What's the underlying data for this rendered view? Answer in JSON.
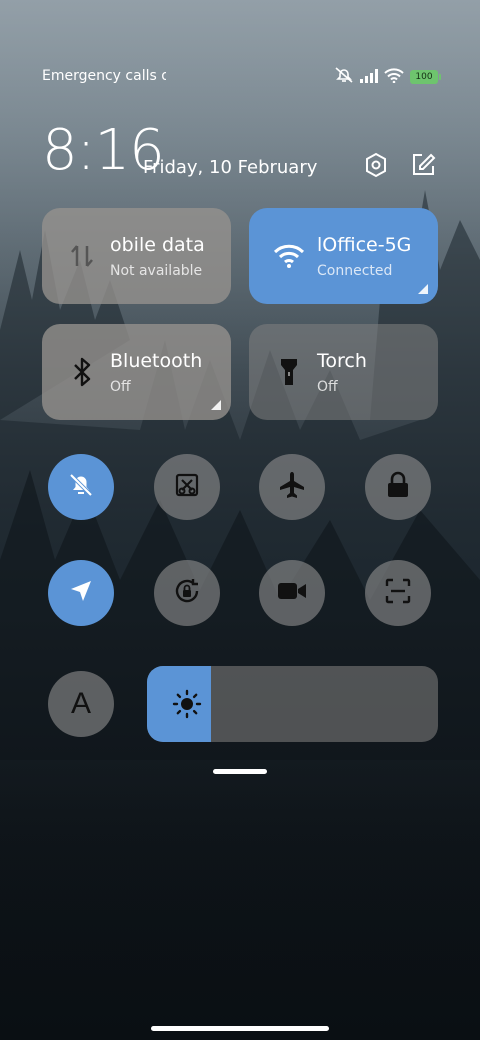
{
  "status_bar": {
    "carrier_text": "Emergency calls o",
    "battery_level": "100",
    "icons": [
      "mute-icon",
      "signal-icon",
      "wifi-icon",
      "battery-icon"
    ]
  },
  "header": {
    "time": "8:16",
    "date": "Friday, 10 February",
    "icons": [
      "settings-icon",
      "edit-icon"
    ]
  },
  "tiles": {
    "mobile_data": {
      "title": "obile data",
      "subtitle": "Not available",
      "icon": "data-arrows-icon",
      "active": false
    },
    "wifi": {
      "title": "lOffice-5G",
      "subtitle": "Connected",
      "icon": "wifi-icon",
      "active": true
    },
    "bluetooth": {
      "title": "Bluetooth",
      "subtitle": "Off",
      "icon": "bluetooth-icon",
      "active": false
    },
    "torch": {
      "title": "Torch",
      "subtitle": "Off",
      "icon": "flashlight-icon",
      "active": false
    }
  },
  "toggles_row1": [
    {
      "name": "silent-mode",
      "icon": "bell-off-icon",
      "active": true
    },
    {
      "name": "screenshot",
      "icon": "scissors-icon",
      "active": false
    },
    {
      "name": "airplane-mode",
      "icon": "airplane-icon",
      "active": false
    },
    {
      "name": "lock-screen",
      "icon": "lock-icon",
      "active": false
    }
  ],
  "toggles_row2": [
    {
      "name": "location",
      "icon": "navigation-arrow-icon",
      "active": true
    },
    {
      "name": "rotation-lock",
      "icon": "rotation-lock-icon",
      "active": false
    },
    {
      "name": "screen-recorder",
      "icon": "video-camera-icon",
      "active": false
    },
    {
      "name": "scanner",
      "icon": "scan-icon",
      "active": false
    }
  ],
  "auto_brightness": {
    "label": "A"
  },
  "brightness": {
    "level_percent": 22,
    "icon": "sun-icon"
  },
  "colors": {
    "accent": "#5b94d6",
    "tile_gray": "#96928e"
  }
}
